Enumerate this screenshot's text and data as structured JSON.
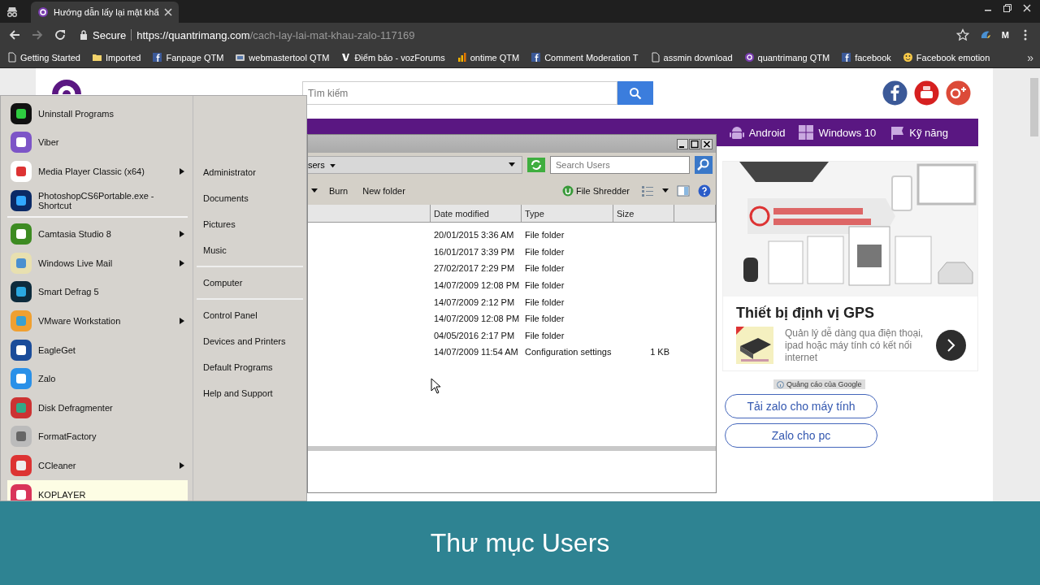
{
  "browser": {
    "tab": {
      "title": "Hướng dẫn lấy lại mật khẩ",
      "selected": true
    },
    "address": {
      "secure_label": "Secure",
      "host": "https://quantrimang.com",
      "path": "/cach-lay-lai-mat-khau-zalo-117169"
    },
    "profile_letter": "M",
    "bookmarks": [
      {
        "kind": "page",
        "label": "Getting Started"
      },
      {
        "kind": "folder",
        "label": "Imported"
      },
      {
        "kind": "facebook",
        "label": "Fanpage QTM"
      },
      {
        "kind": "site",
        "label": "webmastertool QTM"
      },
      {
        "kind": "voz",
        "label": "Điểm báo - vozForums"
      },
      {
        "kind": "chart",
        "label": "ontime QTM"
      },
      {
        "kind": "facebook",
        "label": "Comment Moderation T"
      },
      {
        "kind": "page",
        "label": "assmin download"
      },
      {
        "kind": "qtm",
        "label": "quantrimang QTM"
      },
      {
        "kind": "facebook",
        "label": "facebook"
      },
      {
        "kind": "emoji",
        "label": "Facebook emotion"
      }
    ],
    "bookmarks_more": "»"
  },
  "website": {
    "search": {
      "placeholder": "Tìm kiếm"
    },
    "nav": [
      {
        "kind": "android",
        "label": "Android"
      },
      {
        "kind": "windows",
        "label": "Windows 10"
      },
      {
        "kind": "skills",
        "label": "Kỹ năng"
      }
    ],
    "ad": {
      "kind": "picture",
      "title": "Thiết bị định vị GPS",
      "description": "Quản lý dễ dàng qua điện thoại, ipad hoặc máy tính có kết nối internet"
    },
    "ad_badge": "Quảng cáo của Google",
    "buttons": [
      "Tải zalo cho máy tính",
      "Zalo cho pc"
    ]
  },
  "start_menu": {
    "program_groups": [
      {
        "items": [
          {
            "label": "Uninstall Programs",
            "submenu": false,
            "selected": false
          },
          {
            "label": "Viber",
            "submenu": false,
            "selected": false
          },
          {
            "label": "Media Player Classic (x64)",
            "submenu": true,
            "selected": false
          },
          {
            "label": "PhotoshopCS6Portable.exe - Shortcut",
            "submenu": false,
            "selected": false
          }
        ]
      },
      {
        "items": [
          {
            "label": "Camtasia Studio 8",
            "submenu": true,
            "selected": false
          },
          {
            "label": "Windows Live Mail",
            "submenu": true,
            "selected": false
          },
          {
            "label": "Smart Defrag 5",
            "submenu": false,
            "selected": false
          },
          {
            "label": "VMware Workstation",
            "submenu": true,
            "selected": false
          },
          {
            "label": "EagleGet",
            "submenu": false,
            "selected": false
          },
          {
            "label": "Zalo",
            "submenu": false,
            "selected": false
          },
          {
            "label": "Disk Defragmenter",
            "submenu": false,
            "selected": false
          },
          {
            "label": "FormatFactory",
            "submenu": false,
            "selected": false
          },
          {
            "label": "CCleaner",
            "submenu": true,
            "selected": false
          },
          {
            "label": "KOPLAYER",
            "submenu": false,
            "selected": true
          }
        ]
      }
    ],
    "place_groups": [
      {
        "items": [
          "Administrator",
          "Documents",
          "Pictures",
          "Music"
        ]
      },
      {
        "items": [
          "Computer"
        ]
      },
      {
        "items": [
          "Control Panel",
          "Devices and Printers",
          "Default Programs",
          "Help and Support"
        ]
      }
    ]
  },
  "explorer": {
    "address": "sers",
    "search": {
      "placeholder": "Search Users"
    },
    "toolbar": [
      "Burn",
      "New folder",
      "File Shredder"
    ],
    "columns": [
      "Date modified",
      "Type",
      "Size"
    ],
    "rows": [
      {
        "date": "20/01/2015 3:36 AM",
        "type": "File folder"
      },
      {
        "date": "16/01/2017 3:39 PM",
        "type": "File folder"
      },
      {
        "date": "27/02/2017 2:29 PM",
        "type": "File folder"
      },
      {
        "date": "14/07/2009 12:08 PM",
        "type": "File folder"
      },
      {
        "date": "14/07/2009 2:12 PM",
        "type": "File folder"
      },
      {
        "date": "14/07/2009 12:08 PM",
        "type": "File folder"
      },
      {
        "date": "04/05/2016 2:17 PM",
        "type": "File folder"
      },
      {
        "date": "14/07/2009 11:54 AM",
        "type": "Configuration settings",
        "size": "1 KB"
      }
    ]
  },
  "caption": "Thư mục Users"
}
